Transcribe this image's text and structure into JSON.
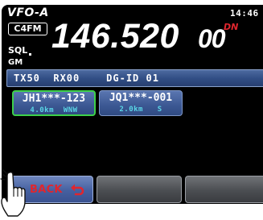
{
  "header": {
    "vfo_label": "VFO-A",
    "clock": "14:46",
    "mode_badge": "C4FM",
    "frequency_main": "146.520",
    "frequency_sub": "00",
    "dn_badge": "DN",
    "sql_label": "SQL",
    "gm_label": "GM"
  },
  "info_bar": {
    "text": "TX50  RX00    DG-ID 01"
  },
  "stations": [
    {
      "callsign": "JH1***-123",
      "info": "4.0km  WNW",
      "selected": true
    },
    {
      "callsign": "JQ1***-001",
      "info": "2.0km   S",
      "selected": false
    }
  ],
  "softkeys": {
    "back_label": "BACK"
  },
  "colors": {
    "screen_bg": "#000000",
    "accent_red": "#e0262e",
    "selected_border": "#3ed14a",
    "info_text_cyan": "#5ad6e6",
    "panel_blue": "#324f86"
  }
}
